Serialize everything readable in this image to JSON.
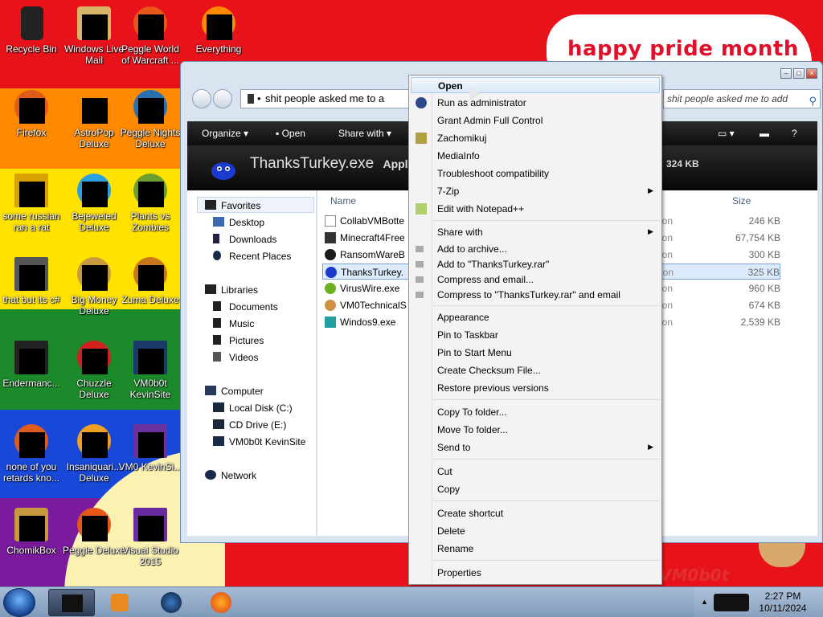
{
  "desktop": {
    "banner": "happy pride month",
    "watermark": "VM0b0t",
    "icons": [
      {
        "label": "Recycle Bin"
      },
      {
        "label": "Windows Live Mail"
      },
      {
        "label": "Peggle World of Warcraft ..."
      },
      {
        "label": "Everything"
      },
      {
        "label": "Firefox"
      },
      {
        "label": "AstroPop Deluxe"
      },
      {
        "label": "Peggle Nights Deluxe"
      },
      {
        "label": "some russian ran a rat"
      },
      {
        "label": "Bejeweled Deluxe"
      },
      {
        "label": "Plants vs Zombies"
      },
      {
        "label": "that but its c#"
      },
      {
        "label": "Big Money Deluxe"
      },
      {
        "label": "Zuma Deluxe"
      },
      {
        "label": "Endermanc..."
      },
      {
        "label": "Chuzzle Deluxe"
      },
      {
        "label": "VM0b0t KevinSite"
      },
      {
        "label": "none of you retards kno..."
      },
      {
        "label": "Insaniquari... Deluxe"
      },
      {
        "label": "VM0 KevinSi..."
      },
      {
        "label": "ChomikBox"
      },
      {
        "label": "Peggle Deluxe"
      },
      {
        "label": "Visual Studio 2015"
      }
    ]
  },
  "explorer": {
    "address": "shit people asked me to a",
    "search_placeholder": "shit people asked me to add",
    "toolbar": {
      "organize": "Organize",
      "open": "Open",
      "share": "Share with"
    },
    "details": {
      "name": "ThanksTurkey.exe",
      "type_partial": "Appl",
      "size": "324 KB"
    },
    "nav": {
      "favorites": "Favorites",
      "desktop": "Desktop",
      "downloads": "Downloads",
      "recent": "Recent Places",
      "libraries": "Libraries",
      "documents": "Documents",
      "music": "Music",
      "pictures": "Pictures",
      "videos": "Videos",
      "computer": "Computer",
      "local_disk": "Local Disk (C:)",
      "cd_drive": "CD Drive (E:)",
      "kevinsite": "VM0b0t KevinSite",
      "network": "Network"
    },
    "columns": {
      "name": "Name",
      "size": "Size"
    },
    "files": [
      {
        "name": "CollabVMBotte",
        "type": "ation",
        "size": "246 KB"
      },
      {
        "name": "Minecraft4Free",
        "type": "ation",
        "size": "67,754 KB"
      },
      {
        "name": "RansomWareB",
        "type": "ation",
        "size": "300 KB"
      },
      {
        "name": "ThanksTurkey.",
        "type": "ation",
        "size": "325 KB"
      },
      {
        "name": "VirusWire.exe",
        "type": "ation",
        "size": "960 KB"
      },
      {
        "name": "VM0TechnicalS",
        "type": "ation",
        "size": "674 KB"
      },
      {
        "name": "Windos9.exe",
        "type": "ation",
        "size": "2,539 KB"
      }
    ]
  },
  "menu": {
    "open": "Open",
    "run_admin": "Run as administrator",
    "grant": "Grant Admin Full Control",
    "zachomikuj": "Zachomikuj",
    "mediainfo": "MediaInfo",
    "troubleshoot": "Troubleshoot compatibility",
    "sevenzip": "7-Zip",
    "notepad": "Edit with Notepad++",
    "share": "Share with",
    "add_archive": "Add to archive...",
    "add_rar": "Add to \"ThanksTurkey.rar\"",
    "compress_email": "Compress and email...",
    "compress_rar_email": "Compress to \"ThanksTurkey.rar\" and email",
    "appearance": "Appearance",
    "pin_taskbar": "Pin to Taskbar",
    "pin_start": "Pin to Start Menu",
    "checksum": "Create Checksum File...",
    "restore": "Restore previous versions",
    "copy_to": "Copy To folder...",
    "move_to": "Move To folder...",
    "send_to": "Send to",
    "cut": "Cut",
    "copy": "Copy",
    "shortcut": "Create shortcut",
    "delete": "Delete",
    "rename": "Rename",
    "properties": "Properties"
  },
  "taskbar": {
    "time": "2:27 PM",
    "date": "10/11/2024"
  }
}
